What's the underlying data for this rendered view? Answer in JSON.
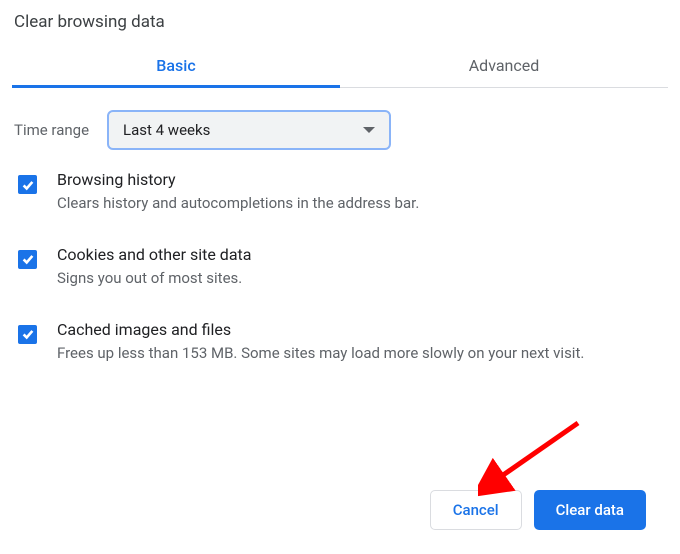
{
  "title": "Clear browsing data",
  "tabs": {
    "basic": "Basic",
    "advanced": "Advanced"
  },
  "range": {
    "label": "Time range",
    "value": "Last 4 weeks"
  },
  "options": [
    {
      "title": "Browsing history",
      "desc": "Clears history and autocompletions in the address bar."
    },
    {
      "title": "Cookies and other site data",
      "desc": "Signs you out of most sites."
    },
    {
      "title": "Cached images and files",
      "desc": "Frees up less than 153 MB. Some sites may load more slowly on your next visit."
    }
  ],
  "buttons": {
    "cancel": "Cancel",
    "clear": "Clear data"
  }
}
